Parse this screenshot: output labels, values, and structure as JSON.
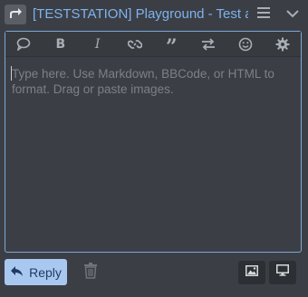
{
  "header": {
    "title": "[TESTSTATION] Playground - Test all...",
    "share_icon": "share-arrow-icon",
    "menu_icon": "hamburger-icon",
    "collapse_icon": "chevron-down-icon"
  },
  "toolbar": {
    "buttons": [
      {
        "name": "speech-bubble-icon"
      },
      {
        "name": "bold-icon",
        "glyph": "B"
      },
      {
        "name": "italic-icon",
        "glyph": "I"
      },
      {
        "name": "link-icon"
      },
      {
        "name": "quote-icon",
        "glyph": "”"
      },
      {
        "name": "swap-arrows-icon"
      },
      {
        "name": "smiley-icon"
      },
      {
        "name": "gear-icon"
      }
    ]
  },
  "editor": {
    "placeholder": "Type here. Use Markdown, BBCode, or HTML to format. Drag or paste images."
  },
  "footer": {
    "reply_label": "Reply",
    "reply_icon": "reply-arrow-icon",
    "discard_icon": "trash-icon",
    "image_icon": "image-icon",
    "preview_icon": "monitor-icon"
  },
  "colors": {
    "background": "#3b3f45",
    "accent": "#7fb2ee",
    "reply_button": "#a9c8f0",
    "border": "#7ea7d8"
  }
}
